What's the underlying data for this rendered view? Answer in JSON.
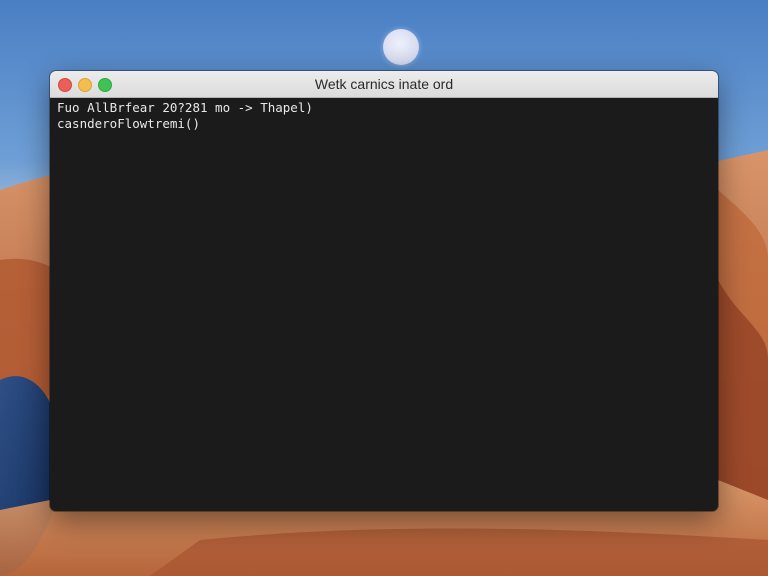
{
  "window": {
    "title": "Wetk carnics inate ord",
    "controls": {
      "close": "close",
      "minimize": "minimize",
      "maximize": "maximize"
    }
  },
  "terminal": {
    "lines": [
      "Fuo AllBrfear 20?281 mo -> Thapel)",
      "casnderoFlowtremi()"
    ]
  },
  "colors": {
    "close": "#ec5f58",
    "minimize": "#f4be4f",
    "maximize": "#3fc453",
    "terminal_bg": "#1b1b1b",
    "terminal_fg": "#e8e8e8"
  },
  "icons": {
    "close": "close-icon",
    "minimize": "minimize-icon",
    "maximize": "maximize-icon"
  }
}
